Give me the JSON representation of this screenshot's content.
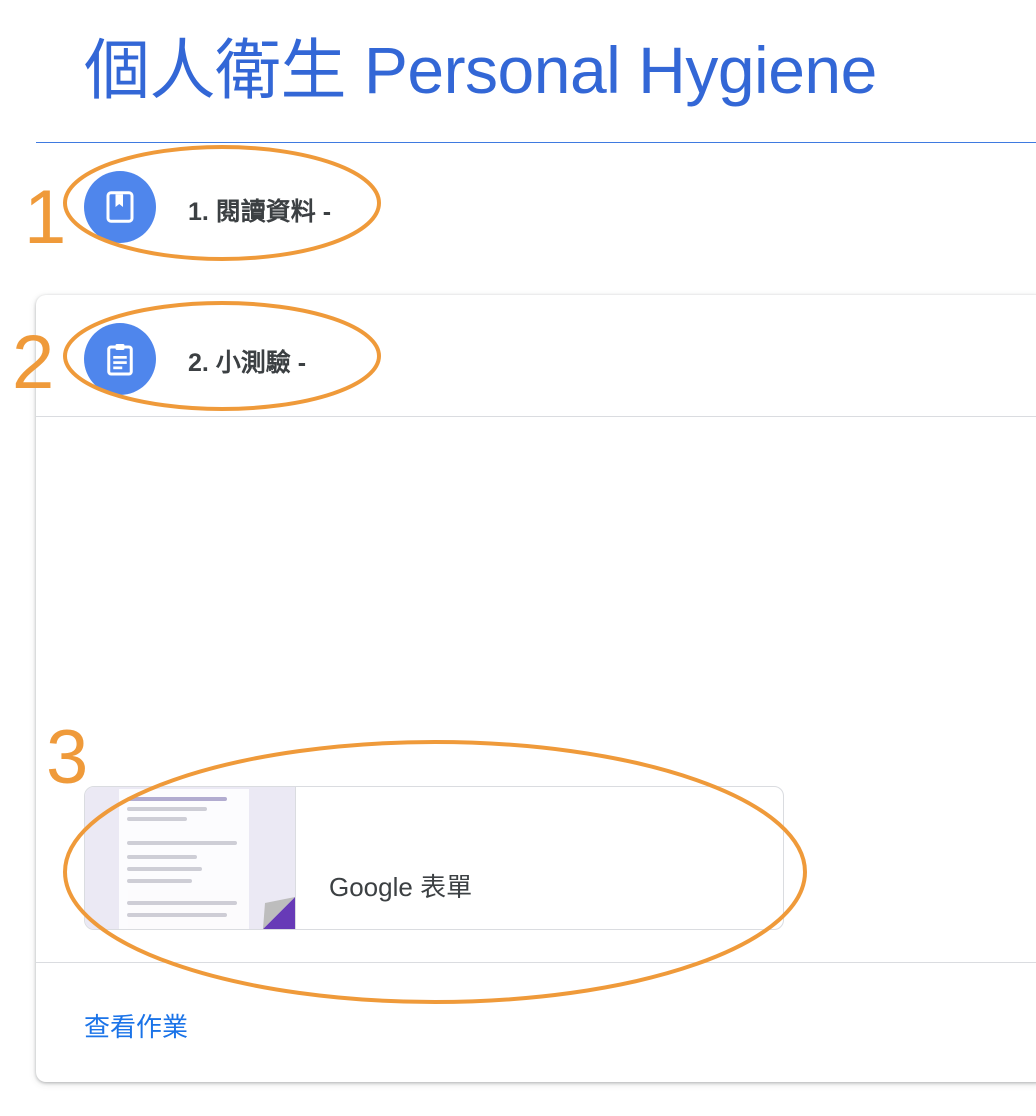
{
  "header": {
    "title": "個人衛生 Personal Hygiene"
  },
  "items": [
    {
      "label": "1. 閱讀資料 -",
      "icon": "bookmark-book-icon"
    },
    {
      "label": "2. 小測驗 -",
      "icon": "clipboard-assignment-icon"
    }
  ],
  "attachment": {
    "title": "Google 表單",
    "icon": "google-forms-thumbnail"
  },
  "card": {
    "view_link": "查看作業"
  },
  "annotations": {
    "n1": "1",
    "n2": "2",
    "n3": "3"
  },
  "colors": {
    "accent": "#3367d6",
    "icon_bg": "#4f86ec",
    "annotation": "#ef9a3a",
    "link": "#1a73e8"
  }
}
